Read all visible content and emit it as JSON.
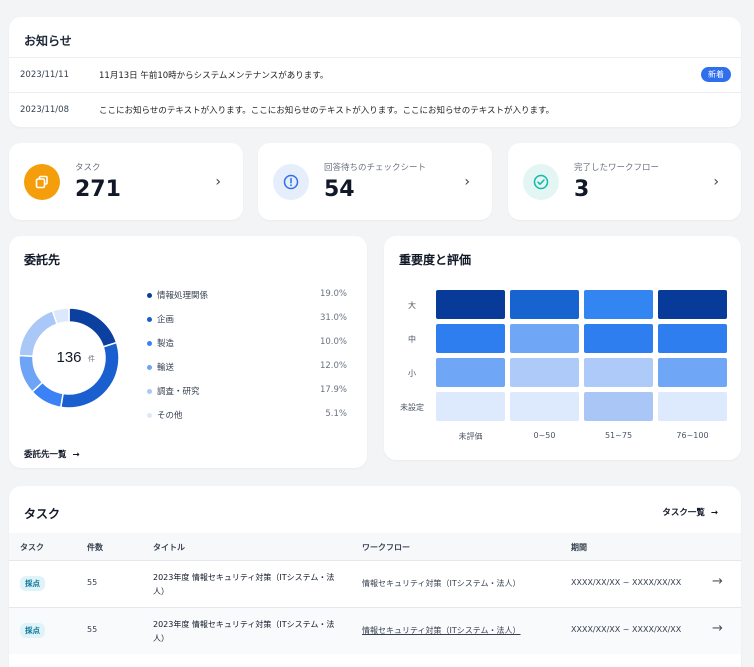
{
  "notice": {
    "title": "お知らせ",
    "items": [
      {
        "date": "2023/11/11",
        "text": "11月13日 午前10時からシステムメンテナンスがあります。",
        "badge": "新着"
      },
      {
        "date": "2023/11/08",
        "text": "ここにお知らせのテキストが入ります。ここにお知らせのテキストが入ります。ここにお知らせのテキストが入ります。",
        "badge": ""
      }
    ]
  },
  "stats": [
    {
      "label": "タスク",
      "value": "271",
      "icon": "copy-icon",
      "color": "#f59e0b"
    },
    {
      "label": "回答待ちのチェックシート",
      "value": "54",
      "icon": "alert-circle-icon",
      "color": "#2f6fed"
    },
    {
      "label": "完了したワークフロー",
      "value": "3",
      "icon": "check-circle-icon",
      "color": "#14b8a6"
    }
  ],
  "outsource": {
    "title": "委託先",
    "total": "136",
    "unit": "件",
    "link": "委託先一覧",
    "legend": [
      {
        "label": "情報処理関係",
        "pct": "19.0%",
        "value": 19.0,
        "color": "#0b3fa0"
      },
      {
        "label": "企画",
        "pct": "31.0%",
        "value": 31.0,
        "color": "#1a5fd0"
      },
      {
        "label": "製造",
        "pct": "10.0%",
        "value": 10.0,
        "color": "#3b82f6"
      },
      {
        "label": "輸送",
        "pct": "12.0%",
        "value": 12.0,
        "color": "#6ea4f5"
      },
      {
        "label": "調査・研究",
        "pct": "17.9%",
        "value": 17.9,
        "color": "#a9c8f7"
      },
      {
        "label": "その他",
        "pct": "5.1%",
        "value": 5.1,
        "color": "#dce8fb"
      }
    ]
  },
  "heatmap": {
    "title": "重要度と評価",
    "rows": [
      "大",
      "中",
      "小",
      "未設定"
    ],
    "cols": [
      "未評価",
      "0~50",
      "51~75",
      "76~100"
    ],
    "colors": [
      [
        "#083a9a",
        "#1763cf",
        "#3385f2",
        "#083a9a"
      ],
      [
        "#2f7ef0",
        "#6fa6f5",
        "#2f7ef0",
        "#2f7ef0"
      ],
      [
        "#6fa6f5",
        "#adcaf8",
        "#adcaf8",
        "#6fa6f5"
      ],
      [
        "#dde9fc",
        "#dde9fc",
        "#a9c6f7",
        "#dde9fc"
      ]
    ]
  },
  "tasks": {
    "title": "タスク",
    "link": "タスク一覧",
    "headers": [
      "タスク",
      "件数",
      "タイトル",
      "ワークフロー",
      "期間"
    ],
    "rows": [
      {
        "tag": "採点",
        "count": "55",
        "title": "2023年度 情報セキュリティ対策（ITシステム・法人）",
        "flow": "情報セキュリティ対策（ITシステム・法人）",
        "period": "XXXX/XX/XX ~ XXXX/XX/XX"
      },
      {
        "tag": "採点",
        "count": "55",
        "title": "2023年度 情報セキュリティ対策（ITシステム・法人）",
        "flow": "情報セキュリティ対策（ITシステム・法人）",
        "period": "XXXX/XX/XX ~ XXXX/XX/XX"
      }
    ]
  }
}
